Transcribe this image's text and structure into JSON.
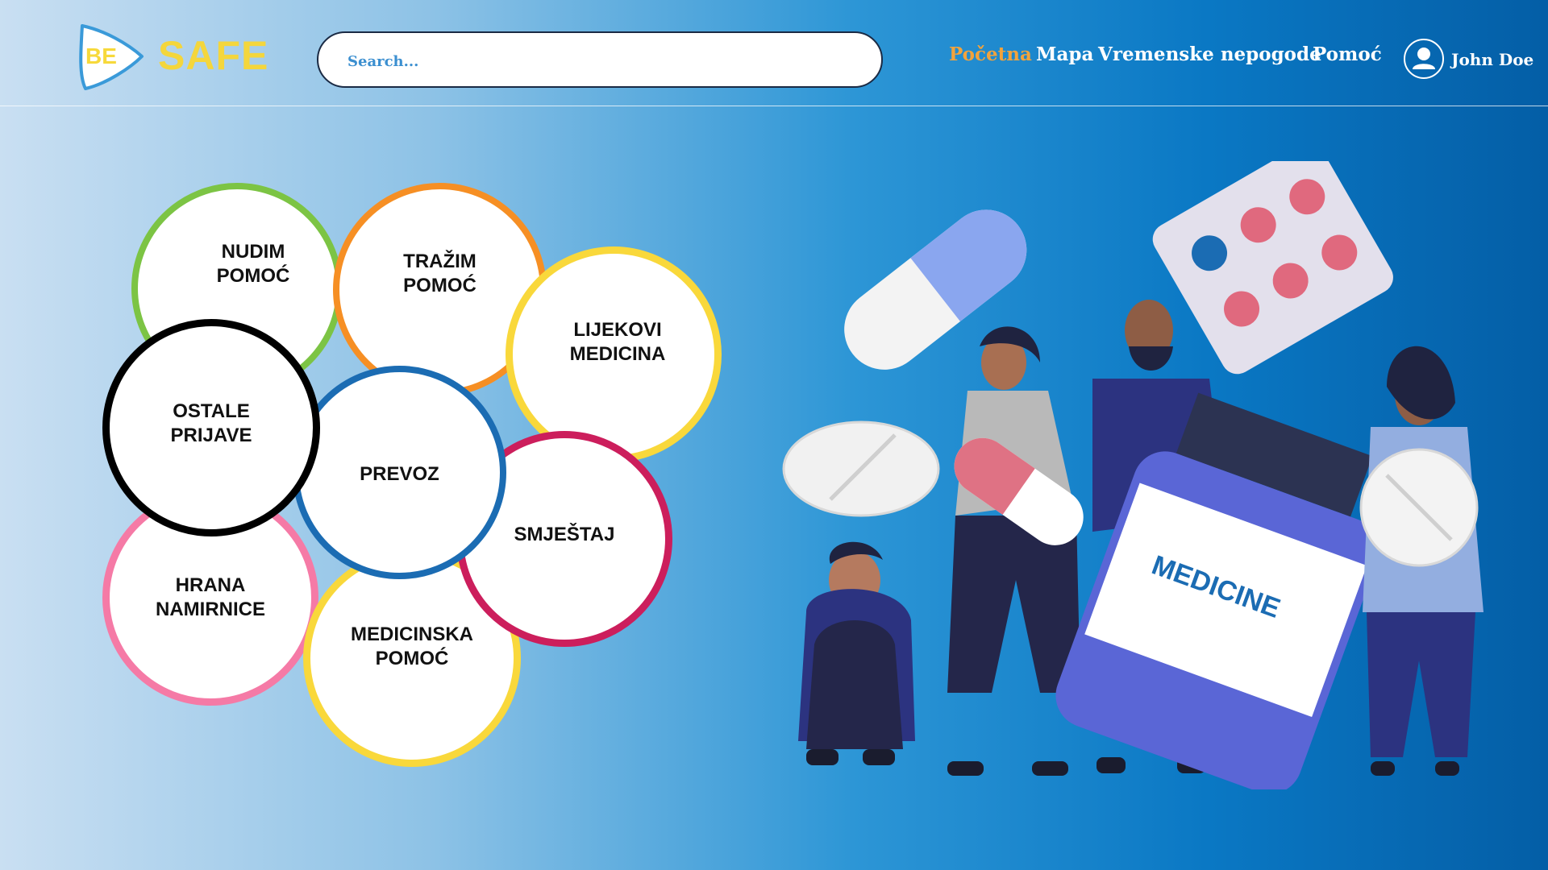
{
  "header": {
    "logo": {
      "prefix": "BE",
      "name": "SAFE"
    },
    "search": {
      "placeholder": "Search..."
    },
    "nav": [
      {
        "label": "Početna",
        "active": true
      },
      {
        "label": "Mapa",
        "active": false
      },
      {
        "label": "Vremenske nepogode",
        "active": false
      },
      {
        "label": "Pomoć",
        "active": false
      }
    ],
    "user": {
      "name": "John Doe",
      "icon": "user-icon"
    }
  },
  "categories": [
    {
      "label": "NUDIM\nPOMOĆ",
      "color": "#7cc444"
    },
    {
      "label": "TRAŽIM\nPOMOĆ",
      "color": "#f68f24"
    },
    {
      "label": "LIJEKOVI\nMEDICINA",
      "color": "#f9d83b"
    },
    {
      "label": "OSTALE\nPRIJAVE",
      "color": "#000000"
    },
    {
      "label": "PREVOZ",
      "color": "#1b6cb3"
    },
    {
      "label": "SMJEŠTAJ",
      "color": "#cc1e5c"
    },
    {
      "label": "HRANA\nNAMIRNICE",
      "color": "#f57aa6"
    },
    {
      "label": "MEDICINSKA\nPOMOĆ",
      "color": "#f9d83b"
    }
  ],
  "illustration": {
    "bottle_label": "MEDICINE"
  },
  "colors": {
    "accent": "#f2a33c",
    "logo": "#f4d63c"
  }
}
